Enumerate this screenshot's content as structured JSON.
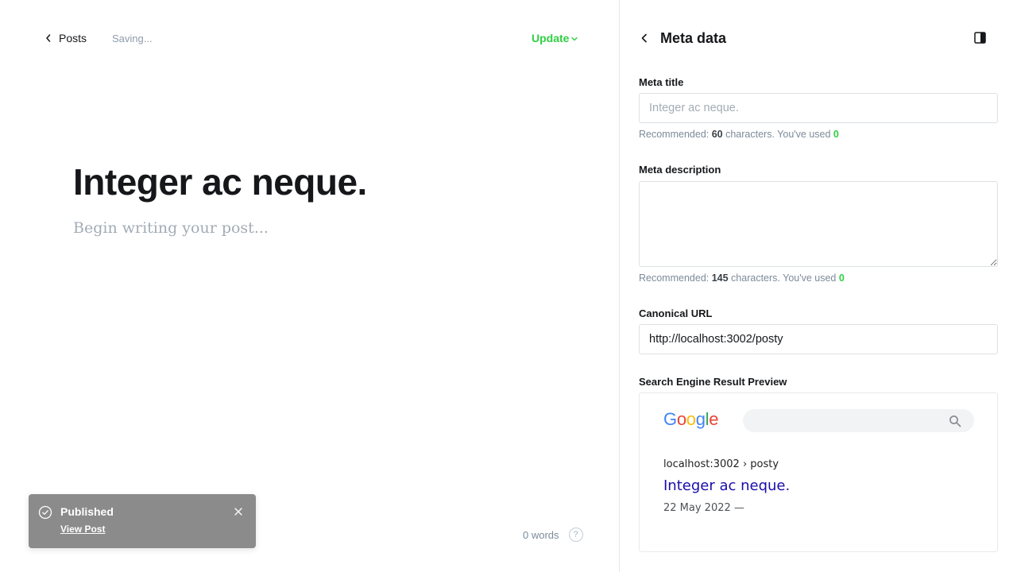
{
  "editor": {
    "back_label": "Posts",
    "status": "Saving...",
    "update_label": "Update",
    "title": "Integer ac neque.",
    "body_placeholder": "Begin writing your post...",
    "word_count": "0 words",
    "help": "?"
  },
  "toast": {
    "title": "Published",
    "link": "View Post"
  },
  "sidebar": {
    "title": "Meta data",
    "meta_title": {
      "label": "Meta title",
      "placeholder": "Integer ac neque.",
      "value": "",
      "hint_prefix": "Recommended: ",
      "hint_count": "60",
      "hint_middle": " characters. You've used ",
      "hint_used": "0"
    },
    "meta_description": {
      "label": "Meta description",
      "value": "",
      "hint_prefix": "Recommended: ",
      "hint_count": "145",
      "hint_middle": " characters. You've used ",
      "hint_used": "0"
    },
    "canonical": {
      "label": "Canonical URL",
      "value": "http://localhost:3002/posty"
    },
    "serp": {
      "label": "Search Engine Result Preview",
      "logo_letters": [
        "G",
        "o",
        "o",
        "g",
        "l",
        "e"
      ],
      "url": "localhost:3002 › posty",
      "title": "Integer ac neque.",
      "date": "22 May 2022 —"
    }
  },
  "colors": {
    "accent_green": "#30cf43",
    "serp_link": "#1a0dab",
    "google_blue": "#4285f4",
    "google_red": "#ea4335",
    "google_yellow": "#fbbc05",
    "google_green": "#34a853"
  }
}
